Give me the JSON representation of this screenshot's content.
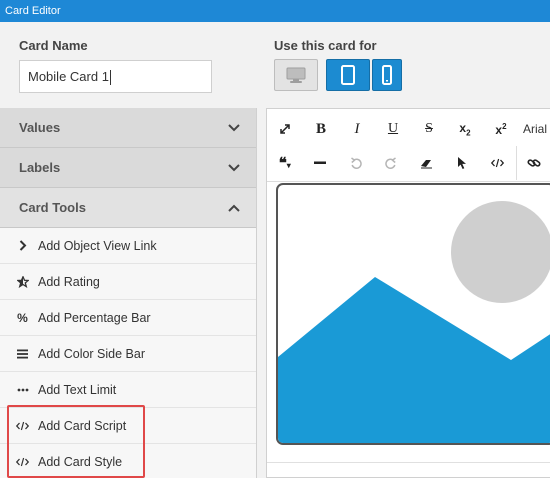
{
  "window": {
    "title": "Card Editor"
  },
  "card_name": {
    "label": "Card Name",
    "value": "Mobile Card 1"
  },
  "use_for": {
    "label": "Use this card for",
    "devices": [
      {
        "name": "desktop",
        "icon": "desktop-icon",
        "active": false
      },
      {
        "name": "tablet",
        "icon": "tablet-icon",
        "active": true
      },
      {
        "name": "mobile",
        "icon": "mobile-icon",
        "active": true
      }
    ]
  },
  "sidebar": {
    "sections": [
      {
        "label": "Values",
        "state": "collapsed",
        "icon": "chevron-down-icon"
      },
      {
        "label": "Labels",
        "state": "collapsed",
        "icon": "chevron-down-icon"
      },
      {
        "label": "Card Tools",
        "state": "expanded",
        "icon": "chevron-up-icon"
      }
    ],
    "tools": [
      {
        "label": "Add Object View Link",
        "icon": "chevron-right-icon"
      },
      {
        "label": "Add Rating",
        "icon": "star-icon"
      },
      {
        "label": "Add Percentage Bar",
        "icon": "percent-icon"
      },
      {
        "label": "Add Color Side Bar",
        "icon": "bars-icon"
      },
      {
        "label": "Add Text Limit",
        "icon": "ellipsis-icon"
      },
      {
        "label": "Add Card Script",
        "icon": "code-icon"
      },
      {
        "label": "Add Card Style",
        "icon": "code-icon"
      }
    ]
  },
  "editor": {
    "font_name": "Arial"
  },
  "colors": {
    "accent": "#1e88d6",
    "highlight": "#e04848",
    "image_blue": "#1a9ad6",
    "image_circle": "#cfcfcf"
  }
}
